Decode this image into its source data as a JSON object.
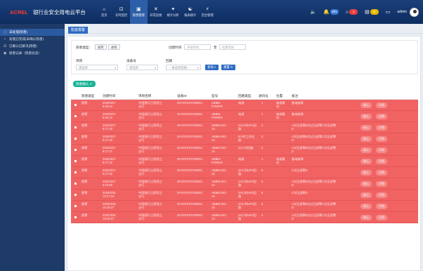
{
  "header": {
    "brand_mark": "ACREL",
    "brand_sub": "银行业安全用电云平台",
    "nav": [
      {
        "icon": "home",
        "glyph": "⌂",
        "label": "首页"
      },
      {
        "icon": "monitor",
        "glyph": "⊡",
        "label": "实时监控"
      },
      {
        "icon": "alarm-manage",
        "glyph": "▣",
        "label": "隐患管理"
      },
      {
        "icon": "daily-ops",
        "glyph": "✕",
        "label": "日常运维"
      },
      {
        "icon": "analysis",
        "glyph": "✦",
        "label": "统计分析"
      },
      {
        "icon": "report",
        "glyph": "☯",
        "label": "报表统计"
      },
      {
        "icon": "backend",
        "glyph": "⚡",
        "label": "后台管理"
      }
    ],
    "notif": [
      {
        "icon": "sound",
        "glyph": "🔈"
      },
      {
        "icon": "bell",
        "glyph": "🔔",
        "count": "981",
        "color": "#3a7bd5"
      },
      {
        "icon": "home-alert",
        "glyph": "⌂",
        "count": "1",
        "color": "#e94040"
      },
      {
        "icon": "calendar",
        "glyph": "▤",
        "count": "8",
        "color": "#e6b800"
      },
      {
        "icon": "chat",
        "glyph": "▭"
      }
    ],
    "user": "admin"
  },
  "sidebar": {
    "items": [
      {
        "icon": "square-outline",
        "glyph": "▢",
        "label": "未处理(隐患)",
        "active": true
      },
      {
        "icon": "pin",
        "glyph": "♆",
        "label": "处理已完成(未确认隐患)"
      },
      {
        "icon": "checkbox",
        "glyph": "☑",
        "label": "已确认已解决(隐患)"
      },
      {
        "icon": "record",
        "glyph": "◉",
        "label": "隐患记录（隐患总览）"
      }
    ]
  },
  "crumb": {
    "tab": "隐患报警"
  },
  "filters": {
    "type_label": "隐患类型：",
    "type_options": [
      "报警",
      "故障"
    ],
    "time_label": "创建时间",
    "start_placeholder": "开始时间",
    "to": "至",
    "end_placeholder": "结束时间",
    "project_label": "项目",
    "project_value": "请选择",
    "device_label": "设备号",
    "device_value": "请选择",
    "loop_label": "回路",
    "loop_value": "---请选择回路---",
    "search_btn": "查询",
    "reset_btn": "重置"
  },
  "confirm_btn": "隐患确认",
  "table": {
    "headers": [
      "隐患类型",
      "创建时间",
      "项目名称",
      "设备ID",
      "型号",
      "回路类型",
      "通讯址",
      "位置",
      "备注"
    ],
    "action1": "确认",
    "action2": "详情",
    "rows": [
      {
        "type": "报警",
        "time": [
          "2020/3/27",
          "9:36:44"
        ],
        "proj": [
          "中国银行江阴滨江",
          "支行"
        ],
        "dev": "ZHYDTEST000001",
        "model": [
          "ABBM-",
          "POWER"
        ],
        "loop": [
          "电源"
        ],
        "addr": "1",
        "pos": [
          "电源模",
          "块"
        ],
        "note": "备电故障"
      },
      {
        "type": "报警",
        "time": [
          "2020/3/27",
          "9:30:24"
        ],
        "proj": [
          "中国银行江阴滨江",
          "支行"
        ],
        "dev": "ZHYDTEST000001",
        "model": [
          "ABBM-",
          "POWER"
        ],
        "loop": [
          "电源"
        ],
        "addr": "1",
        "pos": [
          "电源模",
          "块"
        ],
        "note": "备电故障"
      },
      {
        "type": "报警",
        "time": [
          "2020/3/27",
          "9:17:33"
        ],
        "proj": [
          "中国银行江阴滨江",
          "支行"
        ],
        "dev": "ZHYDTEST000001",
        "model": [
          "ABBM-SIG-",
          "15"
        ],
        "loop": [
          "24小时UPS回",
          "路"
        ],
        "addr": "4",
        "pos": [],
        "note": "A次压部警B次过压部警C次压部警D"
      },
      {
        "type": "报警",
        "time": [
          "2020/3/27",
          "9:17:33"
        ],
        "proj": [
          "中国银行江阴滨江",
          "支行"
        ],
        "dev": "ZHYDTEST000001",
        "model": [
          "ABBM-SIG-",
          "15"
        ],
        "loop": [
          "8小时工作回",
          "路"
        ],
        "addr": "3",
        "pos": [],
        "note": "A次压部警B次过压部警C次压部警D"
      },
      {
        "type": "报警",
        "time": [
          "2020/3/27",
          "9:17:27"
        ],
        "proj": [
          "中国银行江阴滨江",
          "支行"
        ],
        "dev": "ZHYDTEST000001",
        "model": [
          "ABBM-SIG-",
          "15"
        ],
        "loop": [
          "24小时回路"
        ],
        "addr": "2",
        "pos": [],
        "note": "A次压部警B次过压部警C次压部警D"
      },
      {
        "type": "报警",
        "time": [
          "2020/3/27",
          "9:17:22"
        ],
        "proj": [
          "中国银行江阴滨江",
          "支行"
        ],
        "dev": "ZHYDTEST000001",
        "model": [
          "ABBM-",
          "POWER"
        ],
        "loop": [
          "电源"
        ],
        "addr": "1",
        "pos": [
          "电源模",
          "块"
        ],
        "note": "备电故障"
      },
      {
        "type": "报警",
        "time": [
          "2020/3/27",
          "9:17:02"
        ],
        "proj": [
          "中国银行江阴滨江",
          "支行"
        ],
        "dev": "ZHYDTEST000001",
        "model": [
          "ABBM-SIG-",
          "15"
        ],
        "loop": [
          "24小时UPS回",
          "路"
        ],
        "addr": "6",
        "pos": [],
        "note": "C次压部警D"
      },
      {
        "type": "报警",
        "time": [
          "2020/3/27",
          "9:16:55"
        ],
        "proj": [
          "中国银行江阴滨江",
          "支行"
        ],
        "dev": "ZHYDTEST000001",
        "model": [
          "ABBM-SIG-",
          "15"
        ],
        "loop": [
          "24小时UPS回",
          "路"
        ],
        "addr": "5",
        "pos": [],
        "note": "A次压部警B次过压部警C次压部警D"
      },
      {
        "type": "报警",
        "time": [
          "2020/3/26",
          "19:17:18"
        ],
        "proj": [
          "中国银行江阴滨江",
          "支行"
        ],
        "dev": "ZHYDTEST000001",
        "model": [
          "ABBM-SIG-",
          "15"
        ],
        "loop": [
          "24小时UPS回",
          "路"
        ],
        "addr": "6",
        "pos": [],
        "note": "C次压部警D"
      },
      {
        "type": "报警",
        "time": [
          "2020/3/26",
          "19:16:27"
        ],
        "proj": [
          "中国银行江阴滨江",
          "支行"
        ],
        "dev": "ZHYDTEST000001",
        "model": [
          "ABBM-SIG-",
          "15"
        ],
        "loop": [
          "24小时UPS回",
          "路"
        ],
        "addr": "5",
        "pos": [],
        "note": "A次压部警B次过压部警C次压部警D"
      },
      {
        "type": "报警",
        "time": [
          "2020/3/26",
          "19:16:27"
        ],
        "proj": [
          "中国银行江阴滨江",
          "支行"
        ],
        "dev": "ZHYDTEST000001",
        "model": [
          "ABBM-SIG-",
          "15"
        ],
        "loop": [
          "24小时UPS回",
          "路"
        ],
        "addr": "4",
        "pos": [],
        "note": "A次压部警B次过压部警C次压部警D"
      }
    ]
  }
}
